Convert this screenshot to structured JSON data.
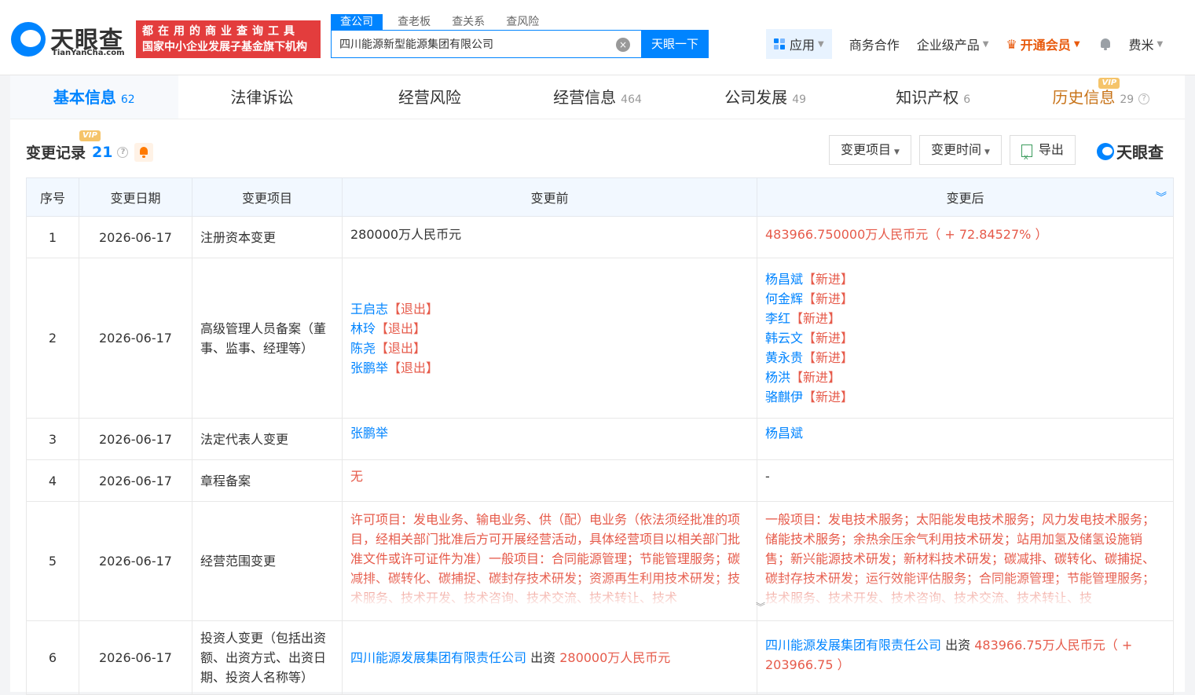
{
  "header": {
    "logo_name": "天眼查",
    "logo_sub": "TianYanCha.com",
    "slogan_1": "都在用的商业查询工具",
    "slogan_2": "国家中小企业发展子基金旗下机构",
    "search_tabs": [
      "查公司",
      "查老板",
      "查关系",
      "查风险"
    ],
    "search_value": "四川能源新型能源集团有限公司",
    "search_button": "天眼一下",
    "nav": {
      "app": "应用",
      "business": "商务合作",
      "enterprise": "企业级产品",
      "vip": "开通会员",
      "user": "费米"
    }
  },
  "tabs": [
    {
      "label": "基本信息",
      "count": "62"
    },
    {
      "label": "法律诉讼",
      "count": ""
    },
    {
      "label": "经营风险",
      "count": ""
    },
    {
      "label": "经营信息",
      "count": "464"
    },
    {
      "label": "公司发展",
      "count": "49"
    },
    {
      "label": "知识产权",
      "count": "6"
    },
    {
      "label": "历史信息",
      "count": "29"
    }
  ],
  "vip_label": "VIP",
  "section": {
    "title": "变更记录",
    "count": "21"
  },
  "filters": {
    "item": "变更项目",
    "time": "变更时间",
    "export": "导出"
  },
  "watermark": "天眼查",
  "table": {
    "headers": [
      "序号",
      "变更日期",
      "变更项目",
      "变更前",
      "变更后"
    ],
    "rows": [
      {
        "no": "1",
        "date": "2026-06-17",
        "item": "注册资本变更",
        "before": "280000万人民币元",
        "after": "483966.750000万人民币元（ + 72.84527% ）"
      },
      {
        "no": "2",
        "date": "2026-06-17",
        "item": "高级管理人员备案（董事、监事、经理等）",
        "before_people": [
          {
            "name": "王启志",
            "tag": "【退出】"
          },
          {
            "name": "林玲",
            "tag": "【退出】"
          },
          {
            "name": "陈尧",
            "tag": "【退出】"
          },
          {
            "name": "张鹏举",
            "tag": "【退出】"
          }
        ],
        "after_people": [
          {
            "name": "杨昌斌",
            "tag": "【新进】"
          },
          {
            "name": "何金辉",
            "tag": "【新进】"
          },
          {
            "name": "李红",
            "tag": "【新进】"
          },
          {
            "name": "韩云文",
            "tag": "【新进】"
          },
          {
            "name": "黄永贵",
            "tag": "【新进】"
          },
          {
            "name": "杨洪",
            "tag": "【新进】"
          },
          {
            "name": "骆麒伊",
            "tag": "【新进】"
          }
        ]
      },
      {
        "no": "3",
        "date": "2026-06-17",
        "item": "法定代表人变更",
        "before": "张鹏举",
        "after": "杨昌斌"
      },
      {
        "no": "4",
        "date": "2026-06-17",
        "item": "章程备案",
        "before": "无",
        "after": "-"
      },
      {
        "no": "5",
        "date": "2026-06-17",
        "item": "经营范围变更",
        "before": "许可项目：发电业务、输电业务、供（配）电业务（依法须经批准的项目，经相关部门批准后方可开展经营活动，具体经营项目以相关部门批准文件或许可证件为准）一般项目：合同能源管理；节能管理服务；碳减排、碳转化、碳捕捉、碳封存技术研发；资源再生利用技术研发；技术服务、技术开发、技术咨询、技术交流、技术转让、技术",
        "after": "一般项目：发电技术服务；太阳能发电技术服务；风力发电技术服务；储能技术服务；余热余压余气利用技术研发；站用加氢及储氢设施销售；新兴能源技术研发；新材料技术研发；碳减排、碳转化、碳捕捉、碳封存技术研发；运行效能评估服务；合同能源管理；节能管理服务；技术服务、技术开发、技术咨询、技术交流、技术转让、技"
      },
      {
        "no": "6",
        "date": "2026-06-17",
        "item": "投资人变更（包括出资额、出资方式、出资日期、投资人名称等）",
        "before_company": "四川能源发展集团有限责任公司",
        "before_mid": " 出资 ",
        "before_amount": "280000万人民币元",
        "after_company": "四川能源发展集团有限责任公司",
        "after_mid": " 出资 ",
        "after_amount": "483966.75万人民币元（ + 203966.75 ）"
      }
    ]
  }
}
